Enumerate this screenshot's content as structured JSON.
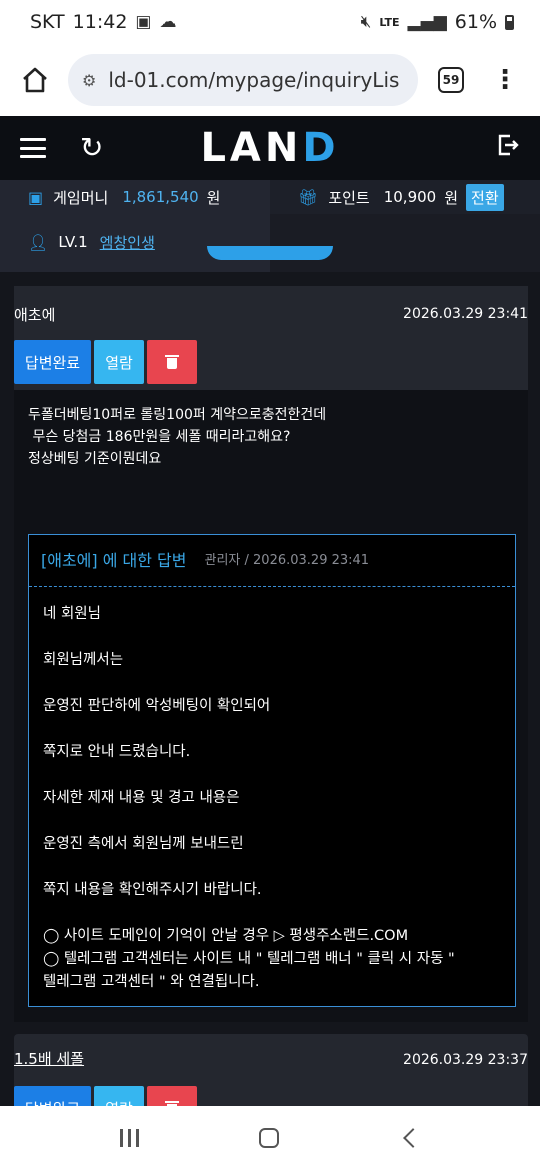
{
  "status_bar": {
    "carrier": "SKT",
    "time": "11:42",
    "network": "LTE",
    "battery": "61%"
  },
  "browser": {
    "url": "ld-01.com/mypage/inquiryLis",
    "tab_count": "59"
  },
  "site": {
    "logo_main": "LAN",
    "logo_accent": "D"
  },
  "account": {
    "money_label": "게임머니",
    "money_value": "1,861,540",
    "money_unit": "원",
    "point_label": "포인트",
    "point_value": "10,900",
    "point_unit": "원",
    "convert_label": "전환",
    "level": "LV.1",
    "nickname": "엠창인생"
  },
  "post1": {
    "author": "애초에",
    "date": "2026.03.29 23:41",
    "btn_done": "답변완료",
    "btn_read": "열람",
    "body_lines": [
      "두폴더베팅10퍼로 롤링100퍼 계약으로충전한건데",
      " 무슨 당첨금 186만원을 세폴 때리라고해요?",
      "정상베팅 기준이뭔데요"
    ],
    "reply": {
      "title": "[애초에] 에 대한 답변",
      "meta": "관리자 / 2026.03.29 23:41",
      "lines": [
        "네 회원님",
        "회원님께서는",
        "운영진 판단하에 악성베팅이 확인되어",
        "쪽지로 안내 드렸습니다.",
        "자세한 제재 내용 및 경고 내용은",
        "운영진 측에서 회원님께 보내드린",
        "쪽지 내용을 확인해주시기 바랍니다."
      ],
      "notes": [
        "◯ 사이트 도메인이 기억이 안날 경우 ▷ 평생주소랜드.COM",
        "◯ 텔레그램 고객센터는 사이트 내 \" 텔레그램 배너 \" 클릭 시 자동 \"",
        "텔레그램 고객센터 \" 와 연결됩니다."
      ]
    }
  },
  "post2": {
    "author": "1.5배 세폴",
    "date": "2026.03.29 23:37",
    "btn_done": "답변완료",
    "btn_read": "열람"
  }
}
